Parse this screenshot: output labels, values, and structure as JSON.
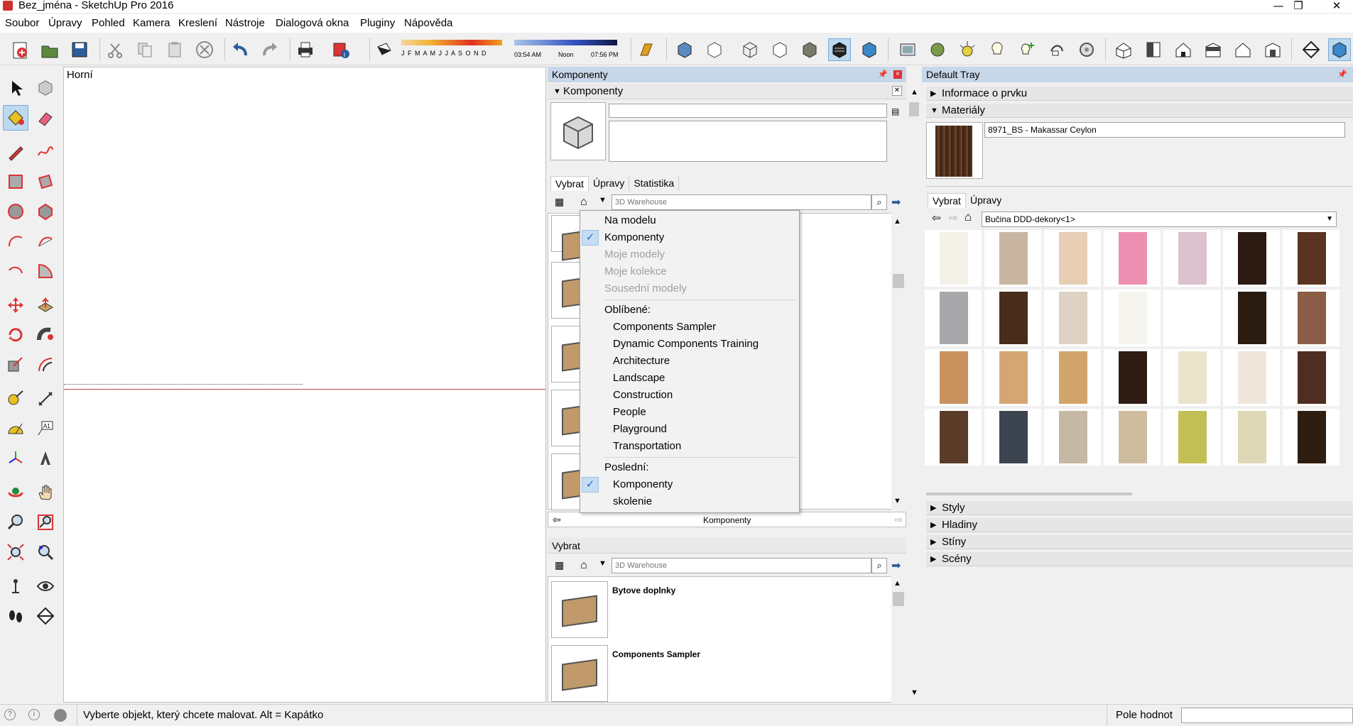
{
  "window": {
    "title": "Bez_jména - SketchUp Pro 2016",
    "minimize": "—",
    "restore": "❐",
    "close": "✕"
  },
  "menu": [
    "Soubor",
    "Úpravy",
    "Pohled",
    "Kamera",
    "Kreslení",
    "Nástroje",
    "Dialogová okna",
    "Pluginy",
    "Nápověda"
  ],
  "shadow": {
    "months": "J F M A M J J A S O N D",
    "time_start": "03:54 AM",
    "time_noon": "Noon",
    "time_end": "07:56 PM"
  },
  "viewport": {
    "label": "Horní"
  },
  "components_panel": {
    "header": "Komponenty",
    "subheader": "Komponenty",
    "tabs": [
      "Vybrat",
      "Úpravy",
      "Statistika"
    ],
    "search_placeholder": "3D Warehouse",
    "footer_label": "Komponenty",
    "lower": {
      "header": "Vybrat",
      "search_placeholder": "3D Warehouse",
      "items": [
        "Bytove doplnky",
        "Components Sampler"
      ]
    }
  },
  "dropdown": {
    "top_items": [
      {
        "label": "Na modelu",
        "checked": false,
        "disabled": false
      },
      {
        "label": "Komponenty",
        "checked": true,
        "disabled": false
      },
      {
        "label": "Moje modely",
        "checked": false,
        "disabled": true
      },
      {
        "label": "Moje kolekce",
        "checked": false,
        "disabled": true
      },
      {
        "label": "Sousední modely",
        "checked": false,
        "disabled": true
      }
    ],
    "favorites_header": "Oblíbené:",
    "favorites": [
      "Components Sampler",
      "Dynamic Components Training",
      "Architecture",
      "Landscape",
      "Construction",
      "People",
      "Playground",
      "Transportation"
    ],
    "recent_header": "Poslední:",
    "recent": [
      {
        "label": "Komponenty",
        "checked": true
      },
      {
        "label": "skolenie",
        "checked": false
      }
    ]
  },
  "tray": {
    "header": "Default Tray",
    "entity_info": "Informace o prvku",
    "materials": "Materiály",
    "material_name": "8971_BS - Makassar Ceylon",
    "tabs": [
      "Vybrat",
      "Úpravy"
    ],
    "library": "Bučina DDD-dekory<1>",
    "collapsed": [
      "Styly",
      "Hladiny",
      "Stíny",
      "Scény"
    ],
    "swatch_colors": [
      "#f4f1e8",
      "#c9b6a2",
      "#e6cdb4",
      "#ec8fb0",
      "#dcc1cf",
      "#2a1a12",
      "#5a3420",
      "#a8a8ab",
      "#4a2c1c",
      "#ddd2c3",
      "#f5f4ee",
      "#ffffff",
      "#2a1c10",
      "#8a5e46",
      "#c8925e",
      "#d4a673",
      "#d1a46c",
      "#2f1c14",
      "#ece3cd",
      "#f0e6dc",
      "#4e2e20",
      "#5a3c28",
      "#3c4450",
      "#c5b8a4",
      "#cdbd9e",
      "#c2c055",
      "#dfd8b6",
      "#2e1e12"
    ]
  },
  "status": {
    "message": "Vyberte objekt, který chcete malovat. Alt = Kapátko",
    "measure_label": "Pole hodnot"
  }
}
